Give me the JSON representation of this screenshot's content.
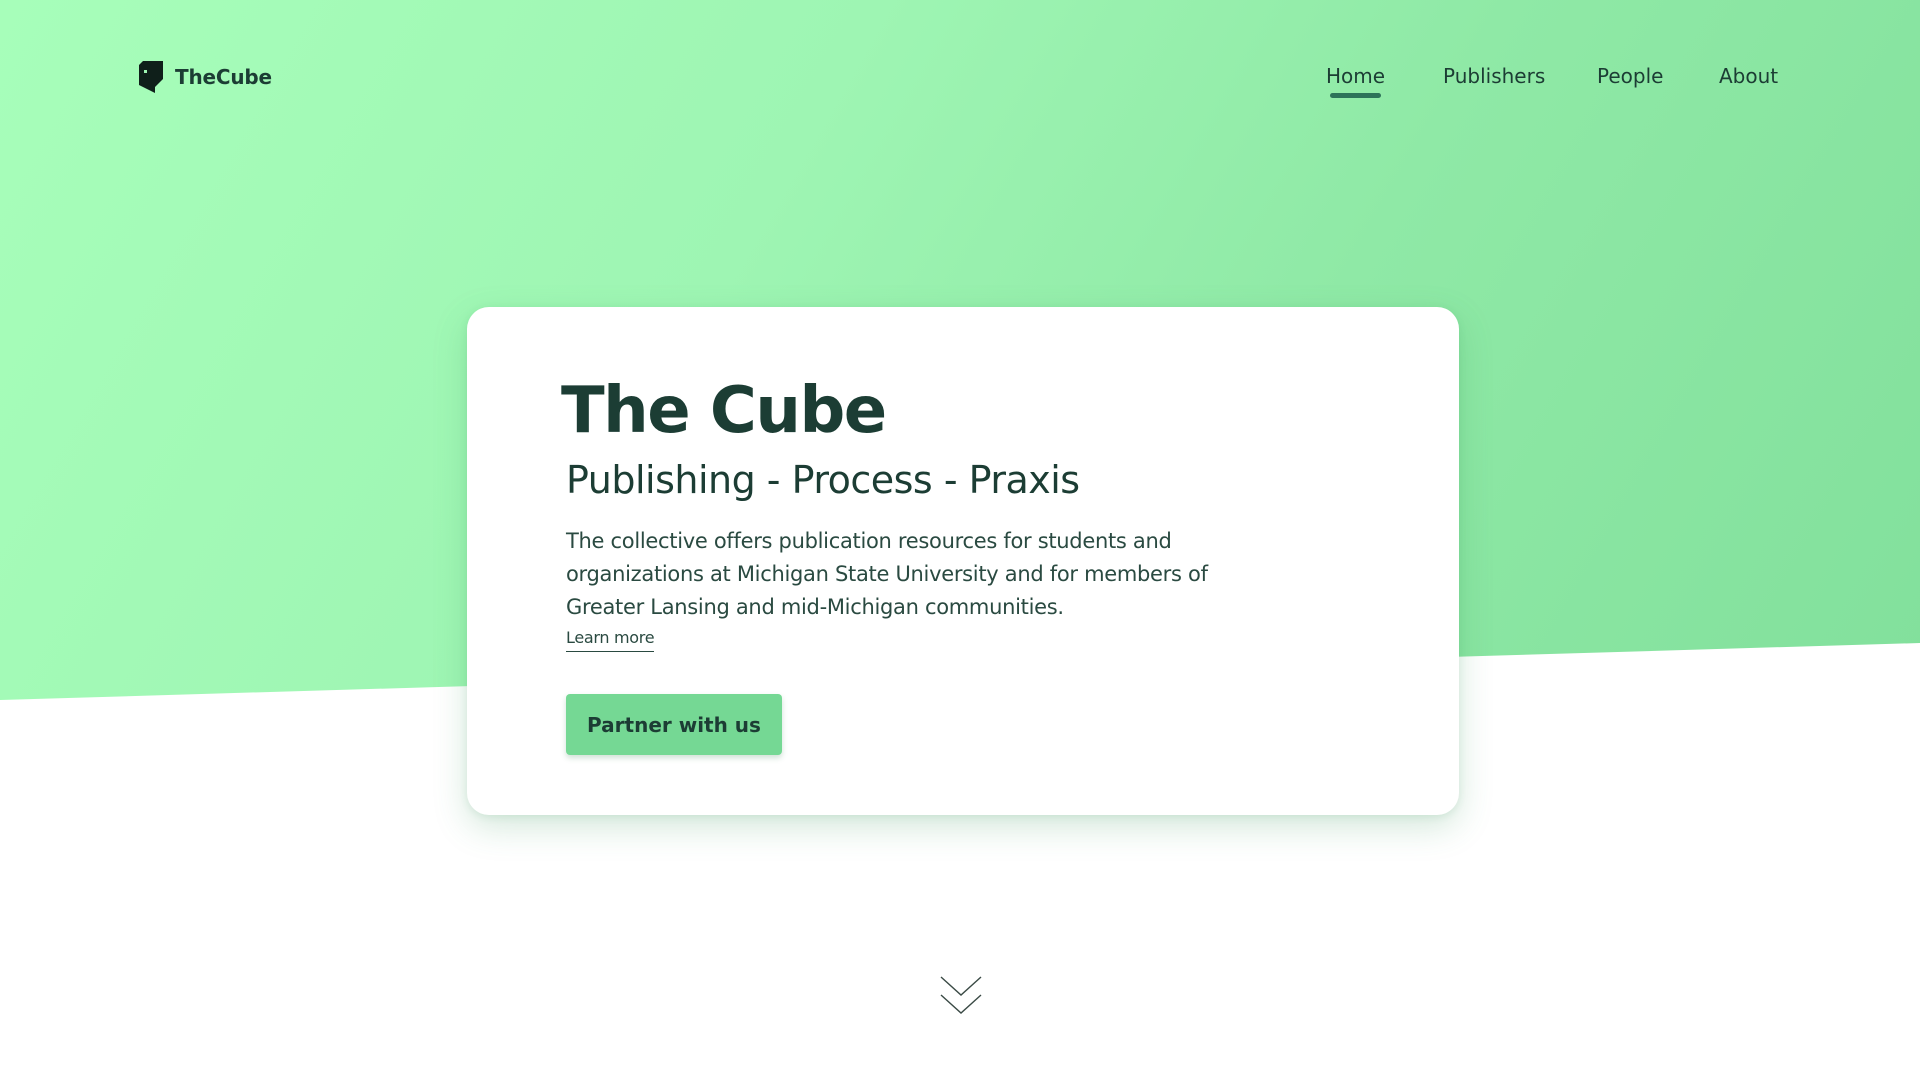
{
  "brand": {
    "name": "TheCube",
    "icon": "cube-logo-icon"
  },
  "nav": {
    "items": [
      {
        "label": "Home",
        "active": true
      },
      {
        "label": "Publishers",
        "active": false
      },
      {
        "label": "People",
        "active": false
      },
      {
        "label": "About",
        "active": false
      }
    ]
  },
  "hero": {
    "title": "The Cube",
    "subtitle": "Publishing - Process - Praxis",
    "description": "The collective offers publication resources for students and organizations at Michigan State University and for members of Greater Lansing and mid-Michigan communities.",
    "learn_more_label": "Learn more",
    "cta_label": "Partner with us"
  },
  "scroll_indicator": {
    "icon": "double-chevron-down-icon"
  },
  "colors": {
    "hero_green_light": "#a7feba",
    "hero_green_dark": "#82e09c",
    "text_dark_green": "#1c3d34",
    "button_green": "#75d894",
    "nav_underline": "#2d7359",
    "card_background": "#ffffff"
  }
}
